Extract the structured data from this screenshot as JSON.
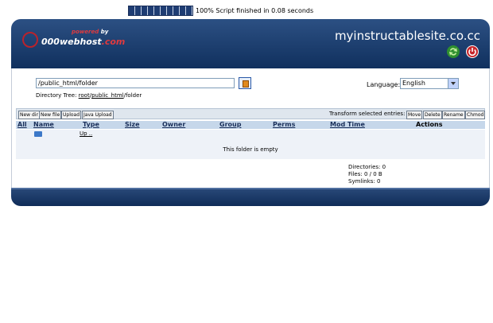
{
  "progress": {
    "blocks": 10,
    "text": "100% Script finished in 0.08 seconds"
  },
  "header": {
    "logo_powered": "powered",
    "logo_by": "by",
    "logo_name": "000webhost",
    "logo_dotcom": ".com",
    "site_title": "myinstructablesite.co.cc",
    "icons": [
      "refresh-icon",
      "power-icon"
    ]
  },
  "location": {
    "path_value": "/public_html/folder",
    "dirtree_label": "Directory Tree:",
    "dirtree_root": "root",
    "dirtree_sep1": "/",
    "dirtree_public": "public_html",
    "dirtree_sep2": "/folder"
  },
  "language": {
    "label": "Language:",
    "selected": "English"
  },
  "toolbar": {
    "new_dir": "New dir",
    "new_file": "New file",
    "upload": "Upload",
    "java_upload": "Java Upload",
    "transform_label": "Transform selected entries:",
    "move": "Move",
    "delete": "Delete",
    "rename": "Rename",
    "chmod": "Chmod"
  },
  "table": {
    "columns": {
      "all": "All",
      "name": "Name",
      "type": "Type",
      "size": "Size",
      "owner": "Owner",
      "group": "Group",
      "perms": "Perms",
      "mod_time": "Mod Time",
      "actions": "Actions"
    },
    "up_label": "Up ..",
    "empty_message": "This folder is empty"
  },
  "stats": {
    "directories": "Directories: 0",
    "files": "Files: 0 / 0 B",
    "symlinks": "Symlinks: 0"
  },
  "colors": {
    "header_top": "#2c5083",
    "header_bottom": "#10305e",
    "table_header": "#c6d7ea",
    "accent_red": "#e03a3e"
  }
}
